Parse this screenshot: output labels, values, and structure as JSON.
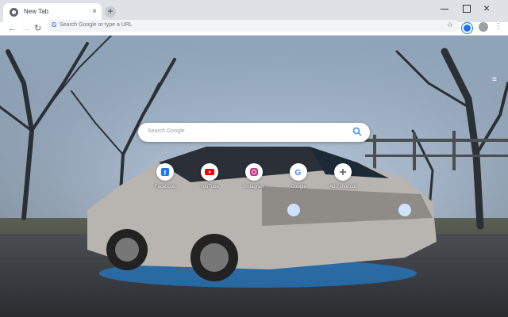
{
  "tab": {
    "title": "New Tab",
    "close": "×"
  },
  "newtab": "+",
  "omnibox": {
    "placeholder": "Search Google or type a URL",
    "g": "G"
  },
  "search": {
    "placeholder": "Search Google"
  },
  "shortcuts": [
    {
      "label": "Facebook",
      "icon": "facebook-icon"
    },
    {
      "label": "YouTube",
      "icon": "youtube-icon"
    },
    {
      "label": "Instagram",
      "icon": "instagram-icon"
    },
    {
      "label": "Google",
      "icon": "google-icon"
    },
    {
      "label": "Add shortcut",
      "icon": "plus-icon"
    }
  ],
  "colors": {
    "accent": "#1a73e8",
    "toolbar": "#ffffff",
    "tabstrip": "#dee1e6"
  }
}
